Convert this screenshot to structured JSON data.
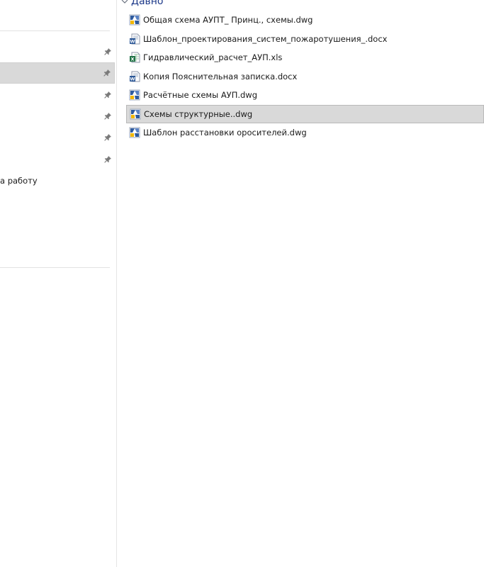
{
  "navigation": {
    "pinned_count": 6,
    "selected_index": 1,
    "partial_text": "а работу"
  },
  "recent": {
    "group_label": "Давно",
    "files": [
      {
        "name": "Общая схема АУПТ_ Принц., схемы.dwg",
        "type": "dwg"
      },
      {
        "name": "Шаблон_проектирования_систем_пожаротушения_.docx",
        "type": "docx"
      },
      {
        "name": "Гидравлический_расчет_АУП.xls",
        "type": "xls"
      },
      {
        "name": "Копия Пояснительная записка.docx",
        "type": "docx"
      },
      {
        "name": "Расчётные схемы АУП.dwg",
        "type": "dwg"
      },
      {
        "name": "Схемы структурные..dwg",
        "type": "dwg",
        "selected": true
      },
      {
        "name": "Шаблон расстановки оросителей.dwg",
        "type": "dwg"
      }
    ]
  },
  "colors": {
    "selection": "#d9d9d9",
    "group_header": "#1e3a8a",
    "word_blue": "#2b5797",
    "excel_green": "#1e7145",
    "dwg_blue": "#2f5b9e",
    "dwg_yellow": "#f2b701"
  }
}
